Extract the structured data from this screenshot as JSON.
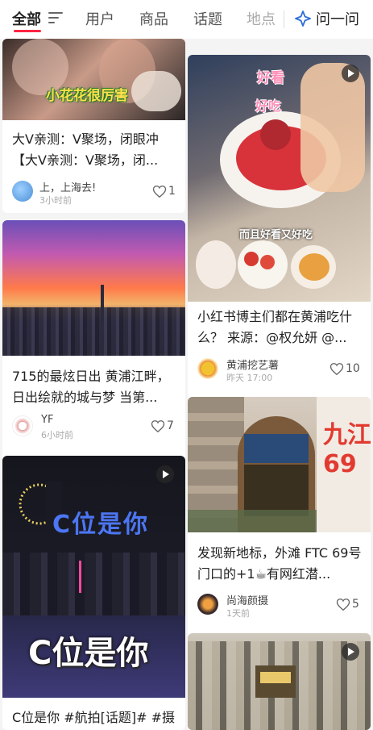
{
  "tabs": {
    "all": "全部",
    "users": "用户",
    "products": "商品",
    "topics": "话题",
    "places": "地点",
    "ask": "问一问"
  },
  "colors": {
    "accent": "#ff2442",
    "ask": "#2d6fd6"
  },
  "icons": {
    "filter": "filter-icon",
    "ask": "sparkle-icon",
    "heart": "heart-icon",
    "play": "play-icon"
  },
  "feed": {
    "left": [
      {
        "overlay": "小花花很厉害",
        "title": "大V亲测：V聚场，闭眼冲【大V亲测：V聚场，闭...",
        "author": "上，上海去!",
        "time": "3小时前",
        "likes": "1"
      },
      {
        "title": "715的最炫日出 黄浦江畔，日出绘就的城与梦 当第...",
        "author": "YF",
        "time": "6小时前",
        "likes": "7"
      },
      {
        "overlay_top": "C位是你",
        "overlay_bottom": "C位是你",
        "title": "C位是你 #航拍[话题]# #摄"
      }
    ],
    "right": [
      {
        "overlay_1": "好看",
        "overlay_2": "好吃",
        "overlay_3": "而且好看又好吃",
        "title": "小红书博主们都在黄浦吃什么？ 来源：@权允妍 @...",
        "author": "黄浦挖艺薯",
        "time": "昨天 17:00",
        "likes": "10"
      },
      {
        "overlay": "九江 69",
        "title": "发现新地标，外滩 FTC 69号门口的+1☕有网红潜...",
        "author": "尚海颜摄",
        "time": "1天前",
        "likes": "5"
      },
      {
        "title": ""
      }
    ]
  }
}
